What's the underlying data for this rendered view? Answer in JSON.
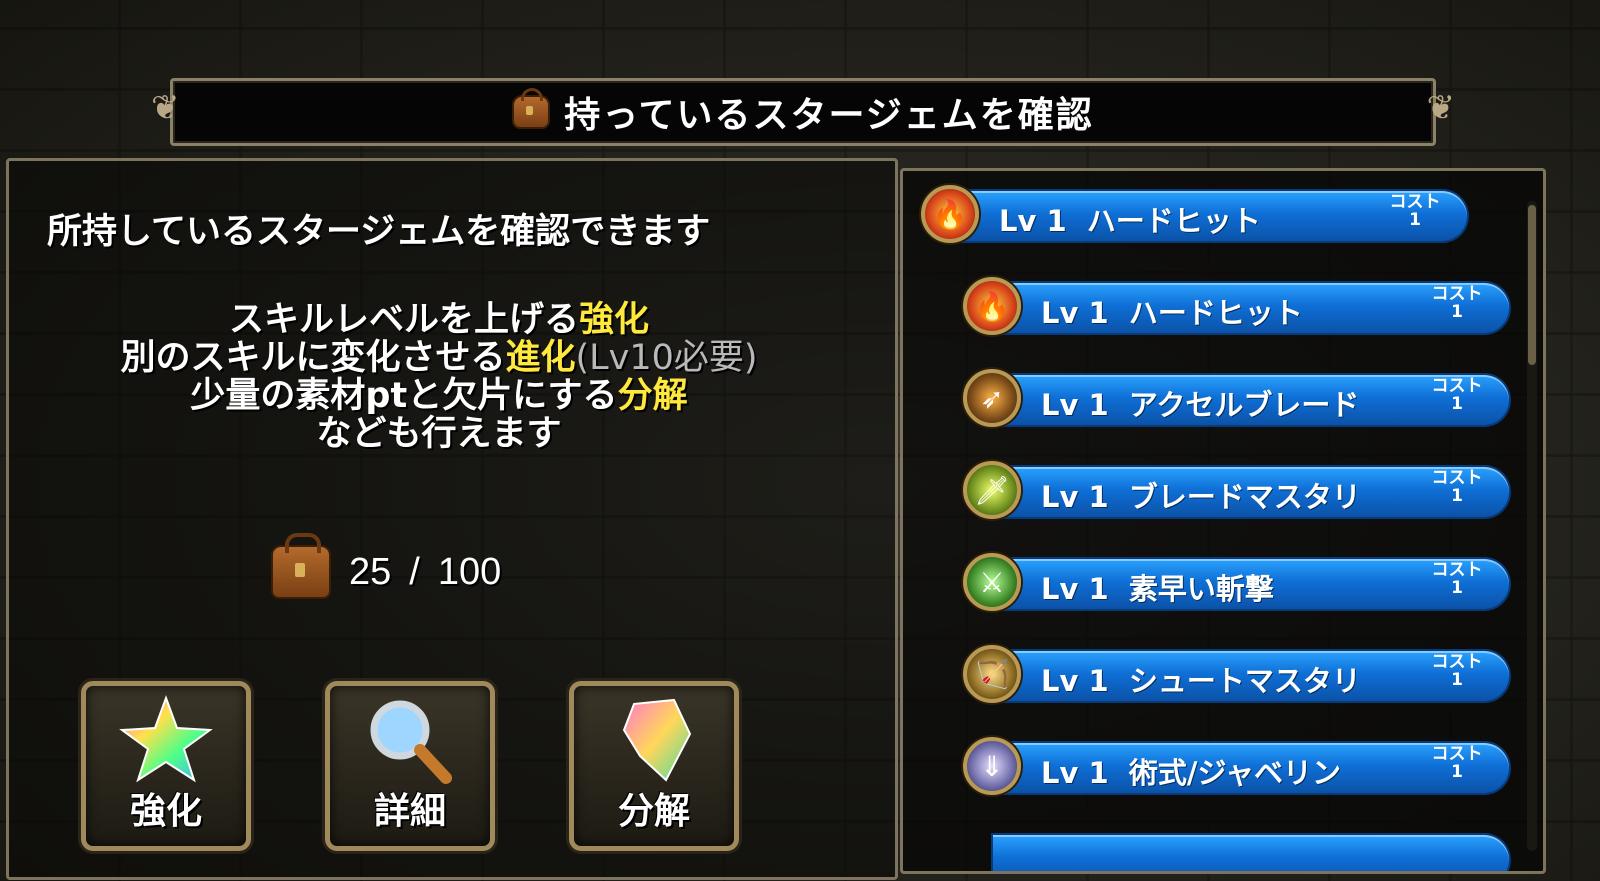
{
  "title": "持っているスタージェムを確認",
  "left_panel": {
    "lead": "所持しているスタージェムを確認できます",
    "desc": {
      "line1_text": "スキルレベルを上げる",
      "line1_highlight": "強化",
      "line2_text": "別のスキルに変化させる",
      "line2_highlight": "進化",
      "line2_note": "(Lv10必要)",
      "line3_text": "少量の素材ptと欠片にする",
      "line3_highlight": "分解",
      "line4_text": "なども行えます"
    },
    "capacity": {
      "current": "25",
      "separator": "/",
      "max": "100"
    },
    "buttons": [
      {
        "label": "強化",
        "icon": "rainbow-star-icon"
      },
      {
        "label": "詳細",
        "icon": "magnifier-icon"
      },
      {
        "label": "分解",
        "icon": "crystal-shard-icon"
      }
    ]
  },
  "skills": [
    {
      "level": "Lv 1",
      "name": "ハードヒット",
      "cost_label": "コスト",
      "cost": "1",
      "icon": "fire-icon"
    },
    {
      "level": "Lv 1",
      "name": "ハードヒット",
      "cost_label": "コスト",
      "cost": "1",
      "icon": "fire-icon"
    },
    {
      "level": "Lv 1",
      "name": "アクセルブレード",
      "cost_label": "コスト",
      "cost": "1",
      "icon": "blade-dash-icon"
    },
    {
      "level": "Lv 1",
      "name": "ブレードマスタリ",
      "cost_label": "コスト",
      "cost": "1",
      "icon": "sword-mastery-icon"
    },
    {
      "level": "Lv 1",
      "name": "素早い斬撃",
      "cost_label": "コスト",
      "cost": "1",
      "icon": "quick-slash-icon"
    },
    {
      "level": "Lv 1",
      "name": "シュートマスタリ",
      "cost_label": "コスト",
      "cost": "1",
      "icon": "bow-mastery-icon"
    },
    {
      "level": "Lv 1",
      "name": "術式/ジャベリン",
      "cost_label": "コスト",
      "cost": "1",
      "icon": "javelin-icon"
    }
  ],
  "colors": {
    "highlight": "#ffe93d",
    "pill": "#0f6fd6",
    "frame": "#8c8066"
  }
}
